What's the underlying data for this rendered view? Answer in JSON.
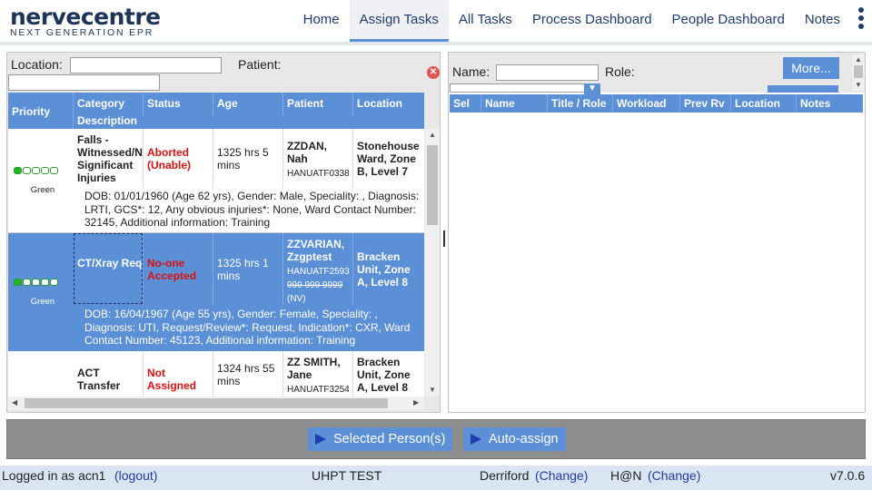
{
  "app": {
    "brand": "nervecentre",
    "tagline": "NEXT GENERATION EPR"
  },
  "nav": {
    "items": [
      "Home",
      "Assign Tasks",
      "All Tasks",
      "Process Dashboard",
      "People Dashboard",
      "Notes"
    ],
    "active": "Assign Tasks"
  },
  "task_filter": {
    "location_label": "Location:",
    "location_value": "",
    "patient_label": "Patient:",
    "patient_value": ""
  },
  "task_table": {
    "headers": {
      "priority": "Priority",
      "category": "Category",
      "description": "Description",
      "status": "Status",
      "age": "Age",
      "patient": "Patient",
      "location": "Location"
    },
    "rows": [
      {
        "priority_level": 1,
        "priority_max": 5,
        "priority_label": "Green",
        "category": "Falls - Witnessed/N Significant Injuries",
        "status": "Aborted (Unable)",
        "age": "1325 hrs 5 mins",
        "patient_name": "ZZDAN, Nah",
        "patient_id": "HANUATF0338",
        "patient_extra": "",
        "location": "Stonehouse Ward, Zone B, Level 7",
        "description": "DOB: 01/01/1960 (Age 62 yrs), Gender: Male, Speciality: , Diagnosis: LRTI, GCS*: 12, Any obvious injuries*: None, Ward Contact Number: 32145, Additional information: Training",
        "selected": false
      },
      {
        "priority_level": 1,
        "priority_max": 5,
        "priority_label": "Green",
        "category": "CT/Xray Request/Re",
        "status": "No-one Accepted",
        "age": "1325 hrs 1 mins",
        "patient_name": "ZZVARIAN, Zzgptest",
        "patient_id": "HANUATF2593",
        "patient_nhs": "999 999 9999",
        "patient_extra": "(NV)",
        "location": "Bracken Unit, Zone A, Level 8",
        "description": "DOB: 16/04/1967 (Age 55 yrs), Gender: Female, Speciality: , Diagnosis: UTI, Request/Review*: Request, Indication*: CXR, Ward Contact Number: 45123, Additional information: Training",
        "selected": true
      },
      {
        "category": "ACT Transfer",
        "status": "Not Assigned",
        "age": "1324 hrs 55 mins",
        "patient_name": "ZZ SMITH, Jane",
        "patient_id": "HANUATF3254",
        "location": "Bracken Unit, Zone A, Level 8",
        "selected": false
      }
    ]
  },
  "people_filter": {
    "name_label": "Name:",
    "name_value": "",
    "role_label": "Role:",
    "more_button": "More..."
  },
  "people_table": {
    "headers": [
      "Sel",
      "Name",
      "Title / Role",
      "Workload",
      "Prev Rv",
      "Location",
      "Notes"
    ],
    "rows": []
  },
  "actions": {
    "selected_persons": "Selected Person(s)",
    "auto_assign": "Auto-assign"
  },
  "footer": {
    "logged_in": "Logged in as acn1",
    "logout": "(logout)",
    "org": "UHPT TEST",
    "site": "Derriford",
    "site_change": "(Change)",
    "mode": "H@N",
    "mode_change": "(Change)",
    "version": "v7.0.6"
  },
  "colors": {
    "accent": "#5b8fd6",
    "status_red": "#dd1111",
    "priority_green": "#1fb81f"
  }
}
